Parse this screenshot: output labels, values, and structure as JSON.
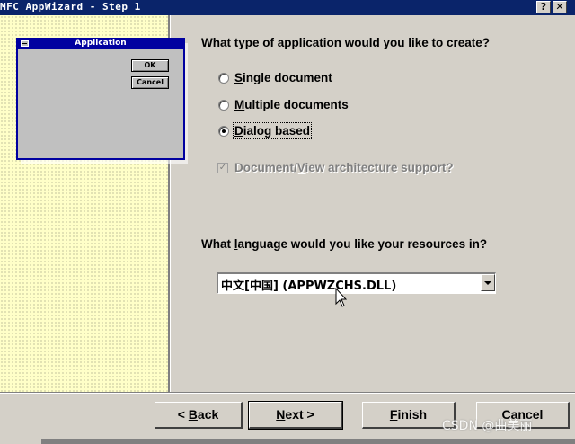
{
  "window": {
    "title": "MFC AppWizard - Step 1",
    "help_button": "?",
    "close_button": "✕",
    "titlebar_color": "#0a246a"
  },
  "preview": {
    "title": "Application",
    "ok_label": "OK",
    "cancel_label": "Cancel"
  },
  "app_type": {
    "question": "What type of application would you like to create?",
    "options": [
      {
        "pre": "",
        "u": "S",
        "post": "ingle document",
        "selected": false
      },
      {
        "pre": "",
        "u": "M",
        "post": "ultiple documents",
        "selected": false
      },
      {
        "pre": "",
        "u": "D",
        "post": "ialog based",
        "selected": true
      }
    ],
    "docview": {
      "pre": "Document/",
      "u": "V",
      "post": "iew architecture support?",
      "checked": true,
      "enabled": false
    }
  },
  "language": {
    "question_pre": "What ",
    "question_u": "l",
    "question_post": "anguage would you like your resources in?",
    "selected_value": "中文[中国] (APPWZCHS.DLL)"
  },
  "buttons": {
    "back_prefix": "< ",
    "back_u": "B",
    "back_rest": "ack",
    "next_u": "N",
    "next_rest": "ext >",
    "finish_u": "F",
    "finish_rest": "inish",
    "cancel": "Cancel"
  },
  "watermark": "CSDN @曲美丽"
}
